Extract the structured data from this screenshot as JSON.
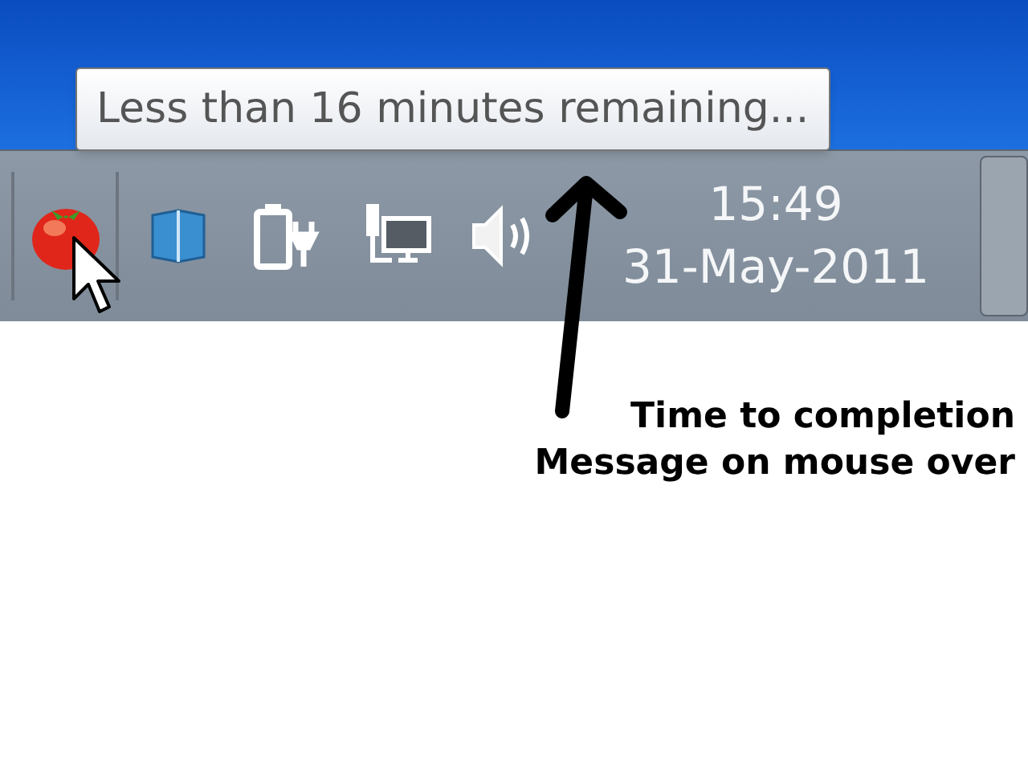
{
  "tooltip": {
    "text": "Less than 16 minutes remaining..."
  },
  "clock": {
    "time": "15:49",
    "date": "31-May-2011"
  },
  "annotation": {
    "lines": [
      "Time to completion",
      "Message on mouse over"
    ]
  }
}
